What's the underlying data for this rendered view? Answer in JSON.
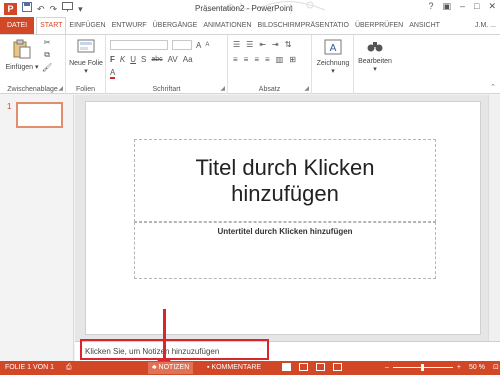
{
  "window": {
    "title": "Präsentation2 - PowerPoint",
    "app_logo": "P"
  },
  "quick_access": {
    "icons": [
      "save-icon",
      "undo-icon",
      "redo-icon",
      "start-from-beginning-icon",
      "customize-icon"
    ]
  },
  "window_controls": {
    "help": "?",
    "ribbon_display": "▣",
    "minimize": "–",
    "restore": "□",
    "close": "✕"
  },
  "tabs": [
    {
      "label": "DATEI"
    },
    {
      "label": "START"
    },
    {
      "label": "EINFÜGEN"
    },
    {
      "label": "ENTWURF"
    },
    {
      "label": "ÜBERGÄNGE"
    },
    {
      "label": "ANIMATIONEN"
    },
    {
      "label": "BILDSCHIRMPRÄSENTATIO"
    },
    {
      "label": "ÜBERPRÜFEN"
    },
    {
      "label": "ANSICHT"
    }
  ],
  "user": "J.M. ...",
  "ribbon": {
    "clipboard": {
      "paste_label": "Einfügen",
      "group_label": "Zwischenablage"
    },
    "slides": {
      "new_slide_label": "Neue Folie",
      "group_label": "Folien"
    },
    "font": {
      "group_label": "Schriftart",
      "bold": "F",
      "italic": "K",
      "underline": "U",
      "strike": "S",
      "abc": "abc",
      "aa": "Aa",
      "color_a": "A"
    },
    "paragraph": {
      "group_label": "Absatz"
    },
    "drawing": {
      "label": "Zeichnung"
    },
    "editing": {
      "label": "Bearbeiten"
    }
  },
  "thumbnails": [
    {
      "number": "1"
    }
  ],
  "slide": {
    "title_placeholder": "Titel durch Klicken hinzufügen",
    "subtitle_placeholder": "Untertitel durch Klicken hinzufügen"
  },
  "notes": {
    "placeholder": "Klicken Sie, um Notizen hinzuzufügen"
  },
  "statusbar": {
    "slide_info": "FOLIE 1 VON 1",
    "notes_label": "NOTIZEN",
    "comments_label": "KOMMENTARE",
    "zoom": "50 %",
    "zoom_minus": "–",
    "zoom_plus": "+"
  },
  "colors": {
    "accent": "#d24726",
    "annotation": "#d9262c"
  }
}
